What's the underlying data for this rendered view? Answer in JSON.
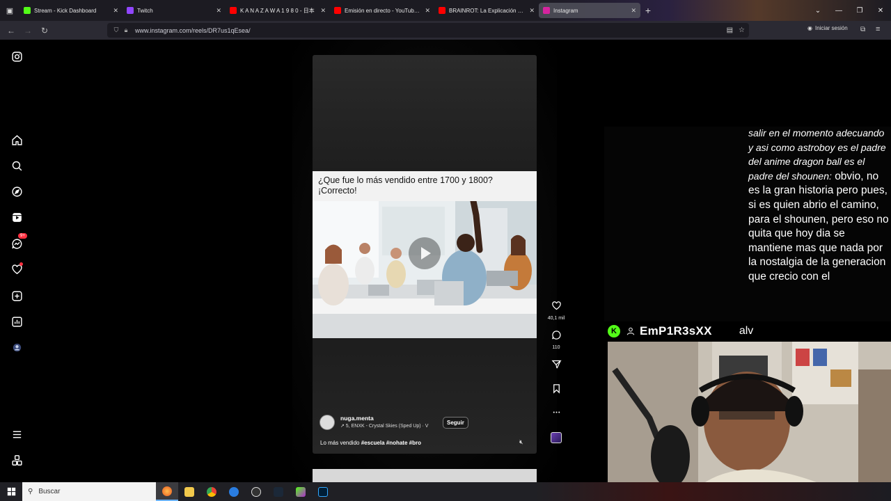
{
  "browser": {
    "tabs": [
      {
        "title": "Stream - Kick Dashboard",
        "color": "#53fc18"
      },
      {
        "title": "Twitch",
        "color": "#9146ff"
      },
      {
        "title": "K A N A Z A W A  1 9 8 0 - 日本",
        "color": "#ff0000"
      },
      {
        "title": "Emisión en directo - YouTube S",
        "color": "#ff0000"
      },
      {
        "title": "BRAINROT: La Explicación Más E",
        "color": "#ff0000"
      },
      {
        "title": "Instagram",
        "color": "#d6249f",
        "active": true
      }
    ],
    "url": "www.instagram.com/reels/DR7us1qEsea/",
    "signin_label": "Iniciar sesión"
  },
  "sidebar": {
    "icons": [
      "instagram-logo-icon",
      "home-icon",
      "search-icon",
      "explore-icon",
      "reels-icon",
      "messages-icon",
      "notifications-icon",
      "create-icon",
      "dashboard-icon",
      "profile-avatar",
      "more-menu-icon",
      "also-from-meta-icon"
    ],
    "messages_badge": "9+"
  },
  "reel": {
    "meme_text_line1": "¿Que fue lo más vendido entre 1700 y 1800?",
    "meme_text_line2": "¡Correcto!",
    "author": "nuga.menta",
    "audio": "↗ 5, ENXK - Crystal Skies (Sped Up) · V",
    "follow_label": "Seguir",
    "caption_text": "Lo más vendido",
    "caption_tags": "#escuela #nohate #bro",
    "likes": "40,1 mil",
    "comments": "110"
  },
  "stream": {
    "chat_italic": "salir en el momento adecuando y asi como astroboy es el padre del anime dragon ball es el padre del shounen:",
    "chat_text": "obvio, no es la gran historia pero pues, si es quien abrio el camino, para el shounen, pero eso no quita que hoy dia se mantiene mas que nada por la nostalgia de la generacion que crecio con el",
    "username": "EmP1R3sXX",
    "user_message": "alv"
  },
  "taskbar": {
    "search_placeholder": "Buscar"
  },
  "colors": {
    "instagram_red": "#ff3040",
    "kick_green": "#53fc18",
    "browser_chrome": "#2b2a33"
  }
}
